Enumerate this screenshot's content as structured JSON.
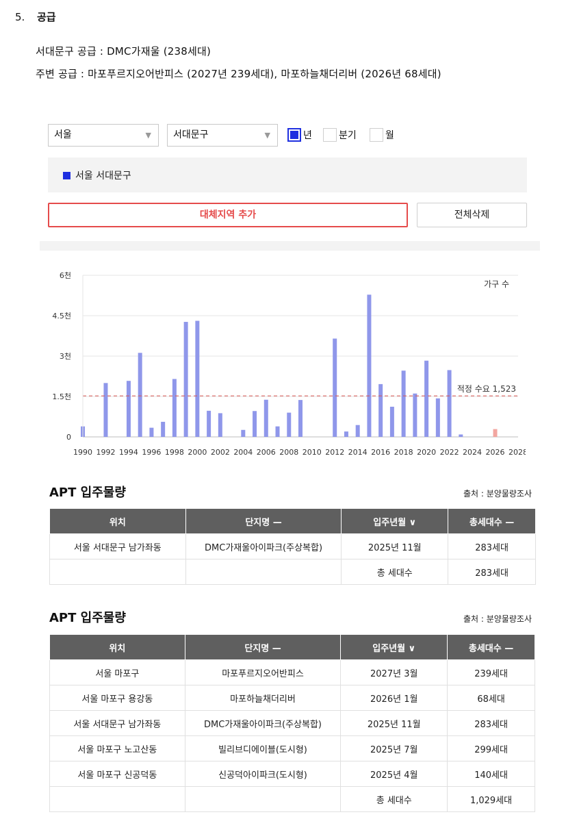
{
  "heading": {
    "number": "5.",
    "title": "공급"
  },
  "supply_line1": "서대문구 공급 : DMC가재울 (238세대)",
  "supply_line2": "주변 공급 : 마포푸르지오어반피스 (2027년 239세대), 마포하늘채더리버 (2026년 68세대)",
  "filters": {
    "city": "서울",
    "district": "서대문구",
    "period": {
      "year": "년",
      "quarter": "분기",
      "month": "월",
      "selected": "year"
    }
  },
  "legend_label": "서울 서대문구",
  "buttons": {
    "add_region": "대체지역 추가",
    "delete_all": "전체삭제"
  },
  "chart_data": {
    "type": "bar",
    "series_label": "가구 수",
    "y_ticks": [
      "0",
      "1.5천",
      "3천",
      "4.5천",
      "6천"
    ],
    "ylim": [
      0,
      6000
    ],
    "x_ticks": [
      "1990",
      "1992",
      "1994",
      "1996",
      "1998",
      "2000",
      "2002",
      "2004",
      "2006",
      "2008",
      "2010",
      "2012",
      "2014",
      "2016",
      "2018",
      "2020",
      "2022",
      "2024",
      "2026",
      "2028"
    ],
    "xlim": [
      1990,
      2028
    ],
    "categories": [
      1990,
      1991,
      1992,
      1993,
      1994,
      1995,
      1996,
      1997,
      1998,
      1999,
      2000,
      2001,
      2002,
      2003,
      2004,
      2005,
      2006,
      2007,
      2008,
      2009,
      2010,
      2011,
      2012,
      2013,
      2014,
      2015,
      2016,
      2017,
      2018,
      2019,
      2020,
      2021,
      2022,
      2023,
      2024,
      2025,
      2026,
      2027
    ],
    "values": [
      390,
      0,
      2000,
      0,
      2080,
      3120,
      340,
      560,
      2150,
      4270,
      4310,
      970,
      880,
      0,
      260,
      960,
      1380,
      390,
      900,
      1370,
      0,
      0,
      3650,
      200,
      440,
      5280,
      1960,
      1120,
      2460,
      1610,
      2830,
      1430,
      2480,
      90,
      0,
      0,
      290,
      0
    ],
    "highlight_category": 2026,
    "colors": {
      "bar": "#8f97ea",
      "highlight": "#f2a6a0",
      "reference": "#d9534f",
      "grid": "#e6e6e6"
    },
    "reference_line": {
      "value": 1523,
      "label": "적정 수요 1,523"
    }
  },
  "table1": {
    "title": "APT 입주물량",
    "source": "출처 : 분양물량조사",
    "headers": [
      "위치",
      "단지명 —",
      "입주년월 ∨",
      "총세대수 —"
    ],
    "rows": [
      [
        "서울 서대문구 남가좌동",
        "DMC가재울아이파크(주상복합)",
        "2025년 11월",
        "283세대"
      ]
    ],
    "total_label": "총 세대수",
    "total_value": "283세대"
  },
  "table2": {
    "title": "APT 입주물량",
    "source": "출처 : 분양물량조사",
    "headers": [
      "위치",
      "단지명 —",
      "입주년월 ∨",
      "총세대수 —"
    ],
    "rows": [
      [
        "서울 마포구",
        "마포푸르지오어반피스",
        "2027년 3월",
        "239세대"
      ],
      [
        "서울 마포구 용강동",
        "마포하늘채더리버",
        "2026년 1월",
        "68세대"
      ],
      [
        "서울 서대문구 남가좌동",
        "DMC가재울아이파크(주상복합)",
        "2025년 11월",
        "283세대"
      ],
      [
        "서울 마포구 노고산동",
        "빌리브디에이블(도시형)",
        "2025년 7월",
        "299세대"
      ],
      [
        "서울 마포구 신공덕동",
        "신공덕아이파크(도시형)",
        "2025년 4월",
        "140세대"
      ]
    ],
    "total_label": "총 세대수",
    "total_value": "1,029세대"
  }
}
